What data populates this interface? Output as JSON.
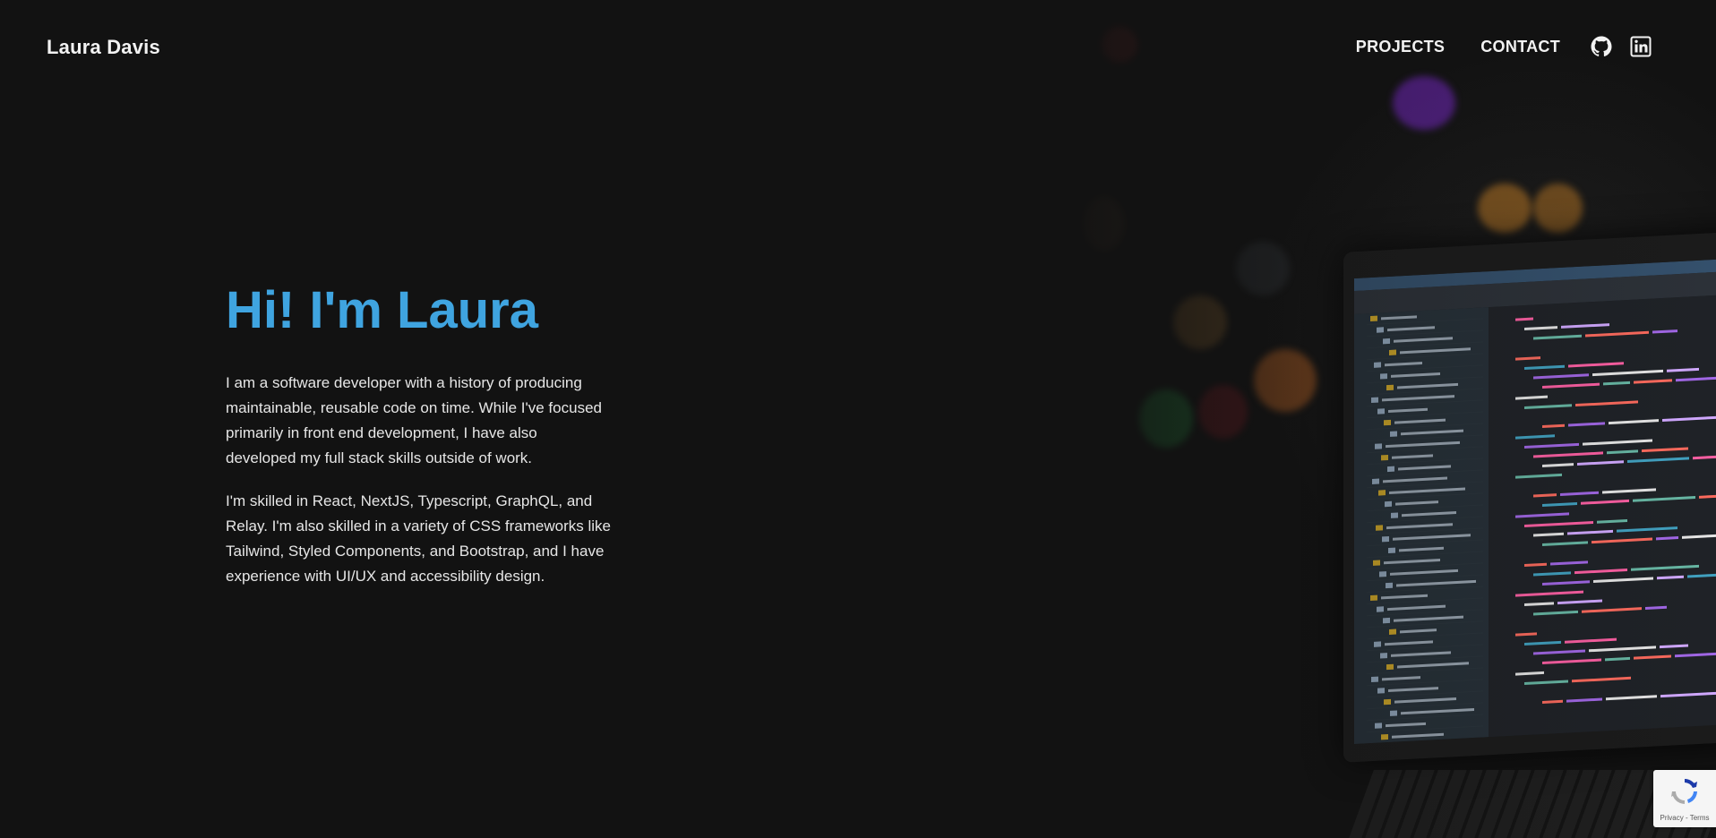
{
  "navbar": {
    "logo": "Laura Davis",
    "links": [
      {
        "label": "PROJECTS"
      },
      {
        "label": "CONTACT"
      }
    ],
    "icons": [
      "github-icon",
      "linkedin-icon"
    ]
  },
  "hero": {
    "title": "Hi! I'm Laura",
    "paragraphs": [
      "I am a software developer with a history of producing maintainable, reusable code on time. While I've focused primarily in front end development, I have also developed my full stack skills outside of work.",
      "I'm skilled in React, NextJS, Typescript, GraphQL, and Relay. I'm also skilled in a variety of CSS frameworks like Tailwind, Styled Components, and Bootstrap, and I have experience with UI/UX and accessibility design."
    ]
  },
  "recaptcha": {
    "privacy": "Privacy",
    "separator": " - ",
    "terms": "Terms"
  },
  "colors": {
    "background": "#121212",
    "accent": "#3fa4e0",
    "text": "#e6e6e6",
    "nav_text": "#f2f2f2"
  }
}
